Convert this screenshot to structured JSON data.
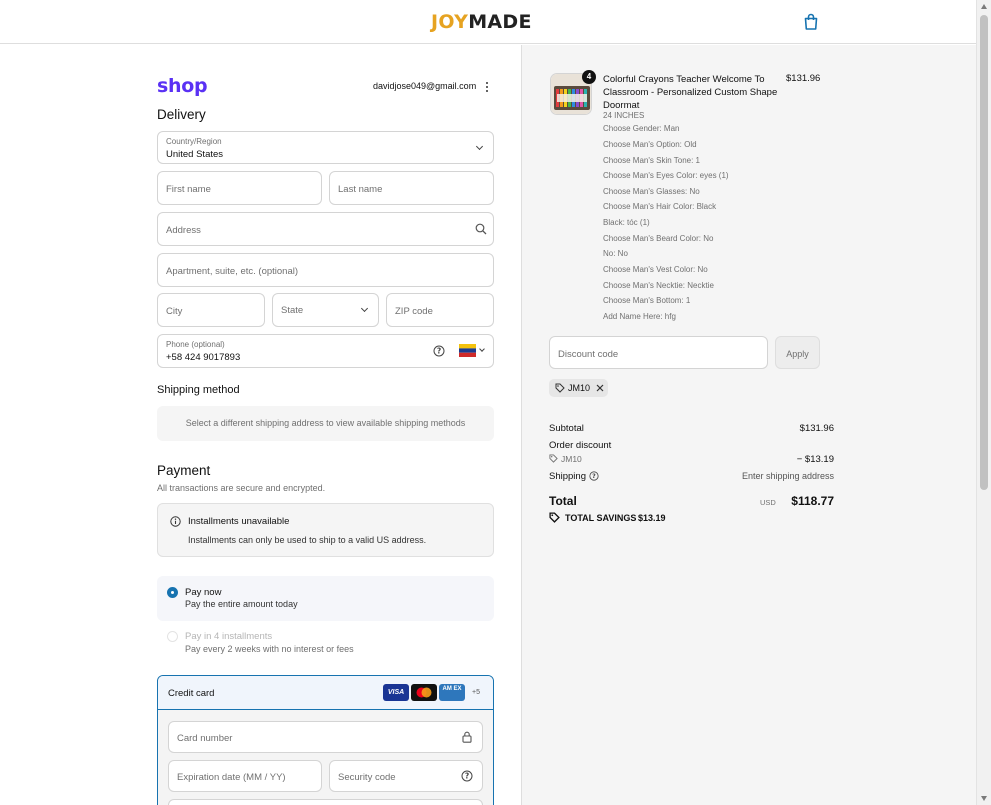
{
  "header": {
    "brand_left": "JOY",
    "brand_right": "MADE"
  },
  "account": {
    "email": "davidjose049@gmail.com"
  },
  "brand_shop": "shop",
  "delivery": {
    "title": "Delivery",
    "country_label": "Country/Region",
    "country_value": "United States",
    "first_name_ph": "First name",
    "last_name_ph": "Last name",
    "address_ph": "Address",
    "apartment_ph": "Apartment, suite, etc. (optional)",
    "city_ph": "City",
    "state_label": "State",
    "zip_ph": "ZIP code",
    "phone_label": "Phone (optional)",
    "phone_value": "+58 424 9017893"
  },
  "shipping": {
    "title": "Shipping method",
    "message": "Select a different shipping address to view available shipping methods"
  },
  "payment": {
    "title": "Payment",
    "subtitle": "All transactions are secure and encrypted.",
    "installments_title": "Installments unavailable",
    "installments_text": "Installments can only be used to ship to a valid US address.",
    "pay_now_label": "Pay now",
    "pay_now_desc": "Pay the entire amount today",
    "pay_4_label": "Pay in 4 installments",
    "pay_4_desc": "Pay every 2 weeks with no interest or fees",
    "credit_card_label": "Credit card",
    "card_visa": "VISA",
    "card_amex": "AM EX",
    "more_cards": "+5",
    "card_number_ph": "Card number",
    "expiry_ph": "Expiration date (MM / YY)",
    "security_ph": "Security code"
  },
  "order": {
    "quantity": "4",
    "product_title": "Colorful Crayons Teacher Welcome To Classroom - Personalized Custom Shape Doormat",
    "product_price": "$131.96",
    "size": "24 INCHES",
    "options": [
      "Choose Gender: Man",
      "Choose Man's Option: Old",
      "Choose Man's Skin Tone: 1",
      "Choose Man's Eyes Color: eyes (1)",
      "Choose Man's Glasses: No",
      "Choose Man's Hair Color: Black",
      "Black: tóc (1)",
      "Choose Man's Beard Color: No",
      "No: No",
      "Choose Man's Vest Color: No",
      "Choose Man's Necktie: Necktie",
      "Choose Man's Bottom: 1",
      "Add Name Here: hfg"
    ],
    "discount_ph": "Discount code",
    "apply_label": "Apply",
    "discount_tag": "JM10",
    "subtotal_label": "Subtotal",
    "subtotal_value": "$131.96",
    "order_discount_label": "Order discount",
    "discount_code": "JM10",
    "discount_value": "− $13.19",
    "shipping_label": "Shipping",
    "shipping_value": "Enter shipping address",
    "total_label": "Total",
    "currency": "USD",
    "total_value": "$118.77",
    "savings_label": "TOTAL SAVINGS",
    "savings_value": "$13.19"
  },
  "colors": {
    "accent": "#1773b0",
    "shop_purple": "#5a31f4",
    "brand_orange": "#e6a321"
  }
}
